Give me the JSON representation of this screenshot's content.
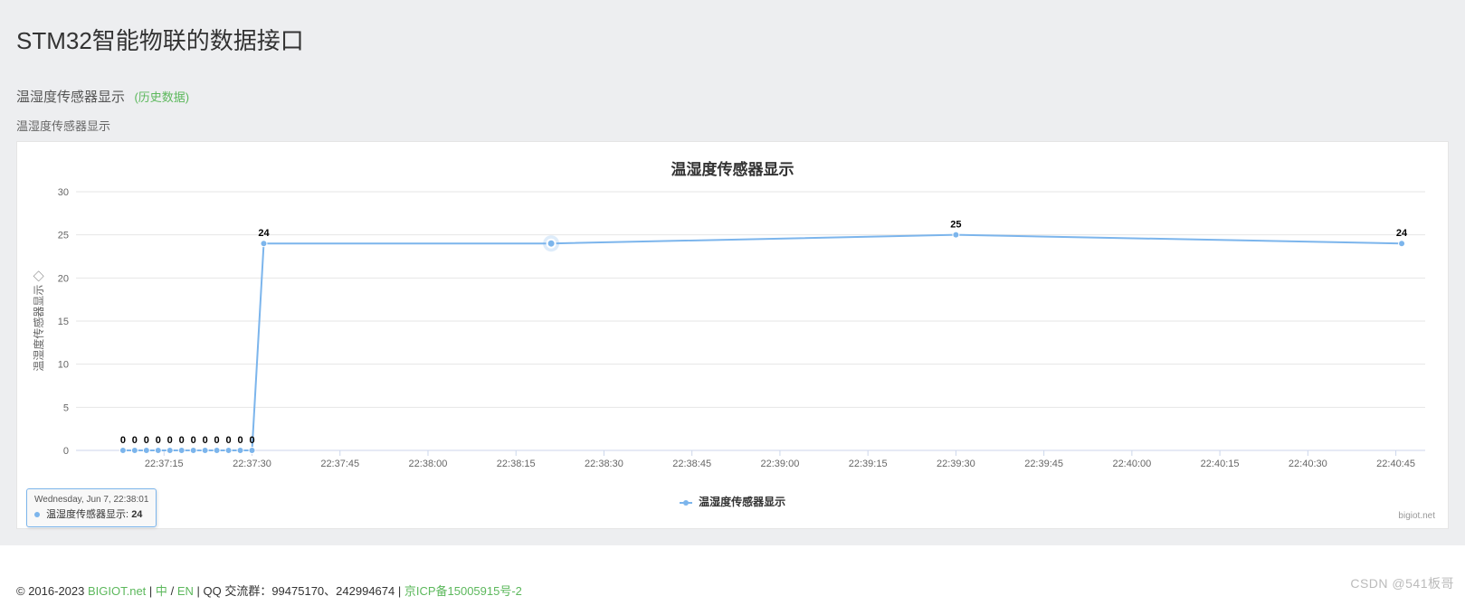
{
  "page": {
    "title": "STM32智能物联的数据接口",
    "section_title": "温湿度传感器显示",
    "history_link": "(历史数据)",
    "chart_subtitle": "温湿度传感器显示"
  },
  "chart_data": {
    "type": "line",
    "title": "温湿度传感器显示",
    "ylabel": "温湿度传感器显示 ◇",
    "ylim": [
      0,
      30
    ],
    "yticks": [
      0,
      5,
      10,
      15,
      20,
      25,
      30
    ],
    "series_name": "温湿度传感器显示",
    "credit": "bigiot.net",
    "x_ticks": [
      "22:37:15",
      "22:37:30",
      "22:37:45",
      "22:38:00",
      "22:38:15",
      "22:38:30",
      "22:38:45",
      "22:39:00",
      "22:39:15",
      "22:39:30",
      "22:39:45",
      "22:40:00",
      "22:40:15",
      "22:40:30",
      "22:40:45"
    ],
    "tooltip": {
      "header": "Wednesday, Jun 7, 22:38:01",
      "label": "温湿度传感器显示:",
      "value": "24",
      "x_sec": 81
    },
    "points": [
      {
        "t": 8,
        "v": 0,
        "lbl": "0"
      },
      {
        "t": 10,
        "v": 0,
        "lbl": "0"
      },
      {
        "t": 12,
        "v": 0,
        "lbl": "0"
      },
      {
        "t": 14,
        "v": 0,
        "lbl": "0"
      },
      {
        "t": 16,
        "v": 0,
        "lbl": "0"
      },
      {
        "t": 18,
        "v": 0,
        "lbl": "0"
      },
      {
        "t": 20,
        "v": 0,
        "lbl": "0"
      },
      {
        "t": 22,
        "v": 0,
        "lbl": "0"
      },
      {
        "t": 24,
        "v": 0,
        "lbl": "0"
      },
      {
        "t": 26,
        "v": 0,
        "lbl": "0"
      },
      {
        "t": 28,
        "v": 0,
        "lbl": "0"
      },
      {
        "t": 30,
        "v": 0,
        "lbl": "0"
      },
      {
        "t": 32,
        "v": 24,
        "lbl": "24"
      },
      {
        "t": 81,
        "v": 24,
        "lbl": ""
      },
      {
        "t": 150,
        "v": 25,
        "lbl": "25"
      },
      {
        "t": 226,
        "v": 24,
        "lbl": "24"
      }
    ],
    "x_range_sec": [
      0,
      230
    ]
  },
  "footer": {
    "copyright": "© 2016-2023 ",
    "site": "BIGIOT.net",
    "sep1": " | ",
    "lang_zh": "中",
    "lang_sep": "/",
    "lang_en": "EN",
    "sep2": " | QQ 交流群：99475170、242994674 | ",
    "icp": "京ICP备15005915号-2"
  },
  "watermark": "CSDN @541板哥"
}
